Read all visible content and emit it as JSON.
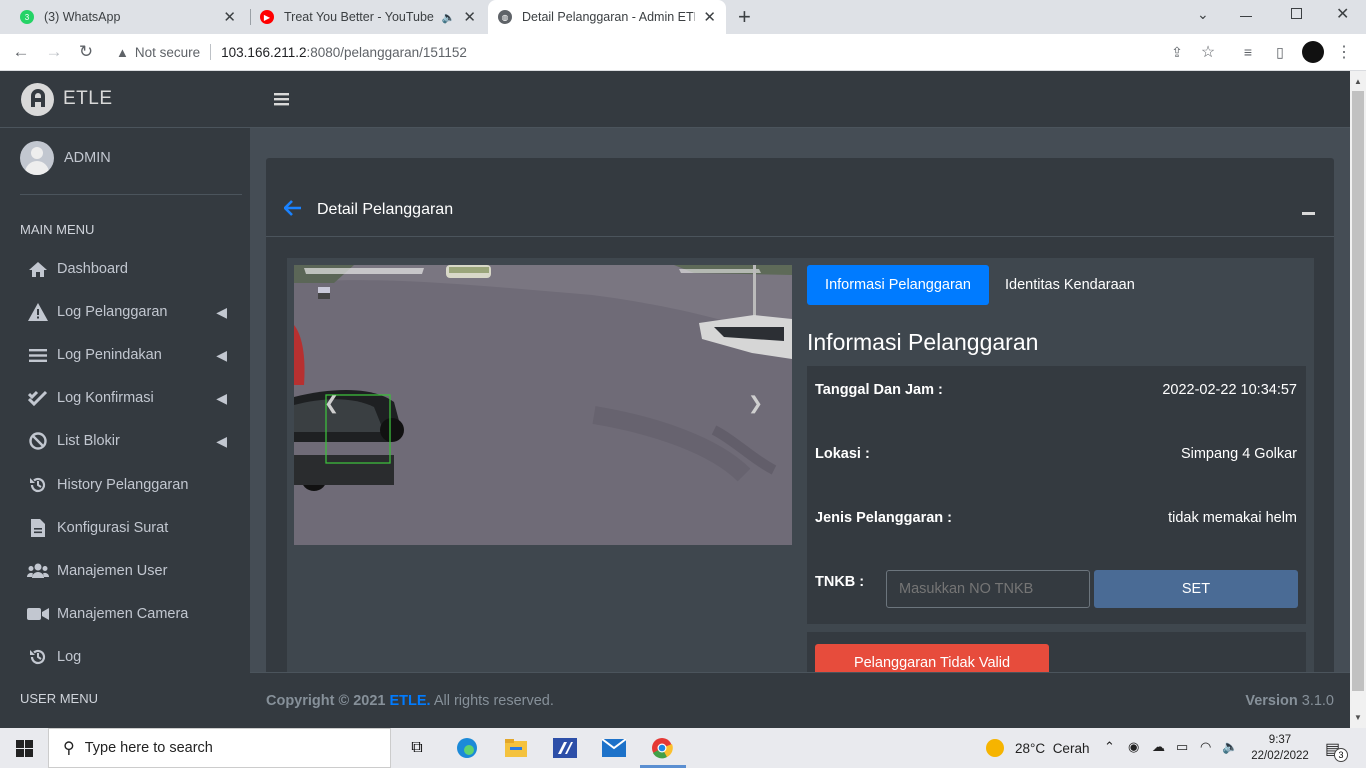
{
  "browser": {
    "tabs": [
      {
        "title": "(3) WhatsApp",
        "badge": "3"
      },
      {
        "title": "Treat You Better - YouTube M"
      },
      {
        "title": "Detail Pelanggaran - Admin ETLE"
      }
    ],
    "new_tab": "+",
    "security": "Not secure",
    "url_host": "103.166.211.2",
    "url_path": ":8080/pelanggaran/151152"
  },
  "sidebar": {
    "brand": "ETLE",
    "user": "ADMIN",
    "main_menu_header": "MAIN MENU",
    "user_menu_header": "USER MENU",
    "items": [
      {
        "label": "Dashboard",
        "icon": "home-icon"
      },
      {
        "label": "Log Pelanggaran",
        "icon": "warning-icon"
      },
      {
        "label": "Log Penindakan",
        "icon": "list-icon"
      },
      {
        "label": "Log Konfirmasi",
        "icon": "check-icon"
      },
      {
        "label": "List Blokir",
        "icon": "ban-icon"
      },
      {
        "label": "History Pelanggaran",
        "icon": "history-icon"
      },
      {
        "label": "Konfigurasi Surat",
        "icon": "file-icon"
      },
      {
        "label": "Manajemen User",
        "icon": "users-icon"
      },
      {
        "label": "Manajemen Camera",
        "icon": "video-icon"
      },
      {
        "label": "Log",
        "icon": "history-icon"
      }
    ]
  },
  "page": {
    "title": "Detail Pelanggaran",
    "tabs": [
      "Informasi Pelanggaran",
      "Identitas Kendaraan"
    ],
    "section_title": "Informasi Pelanggaran",
    "fields": {
      "datetime_label": "Tanggal Dan Jam :",
      "datetime_value": "2022-02-22 10:34:57",
      "location_label": "Lokasi :",
      "location_value": "Simpang 4 Golkar",
      "type_label": "Jenis Pelanggaran :",
      "type_value": "tidak memakai helm",
      "tnkb_label": "TNKB :",
      "tnkb_placeholder": "Masukkan NO TNKB",
      "set_button": "SET"
    },
    "invalid_button": "Pelanggaran Tidak Valid"
  },
  "footer": {
    "copyright": "Copyright © 2021",
    "brand": "ETLE.",
    "rights": "All rights reserved.",
    "version_label": "Version",
    "version": "3.1.0"
  },
  "taskbar": {
    "search_placeholder": "Type here to search",
    "weather_temp": "28°C",
    "weather_desc": "Cerah",
    "time": "9:37",
    "date": "22/02/2022",
    "notifications": "3"
  },
  "colors": {
    "accent": "#007bff",
    "danger": "#e74c3c",
    "set_button": "#4a6b95"
  }
}
